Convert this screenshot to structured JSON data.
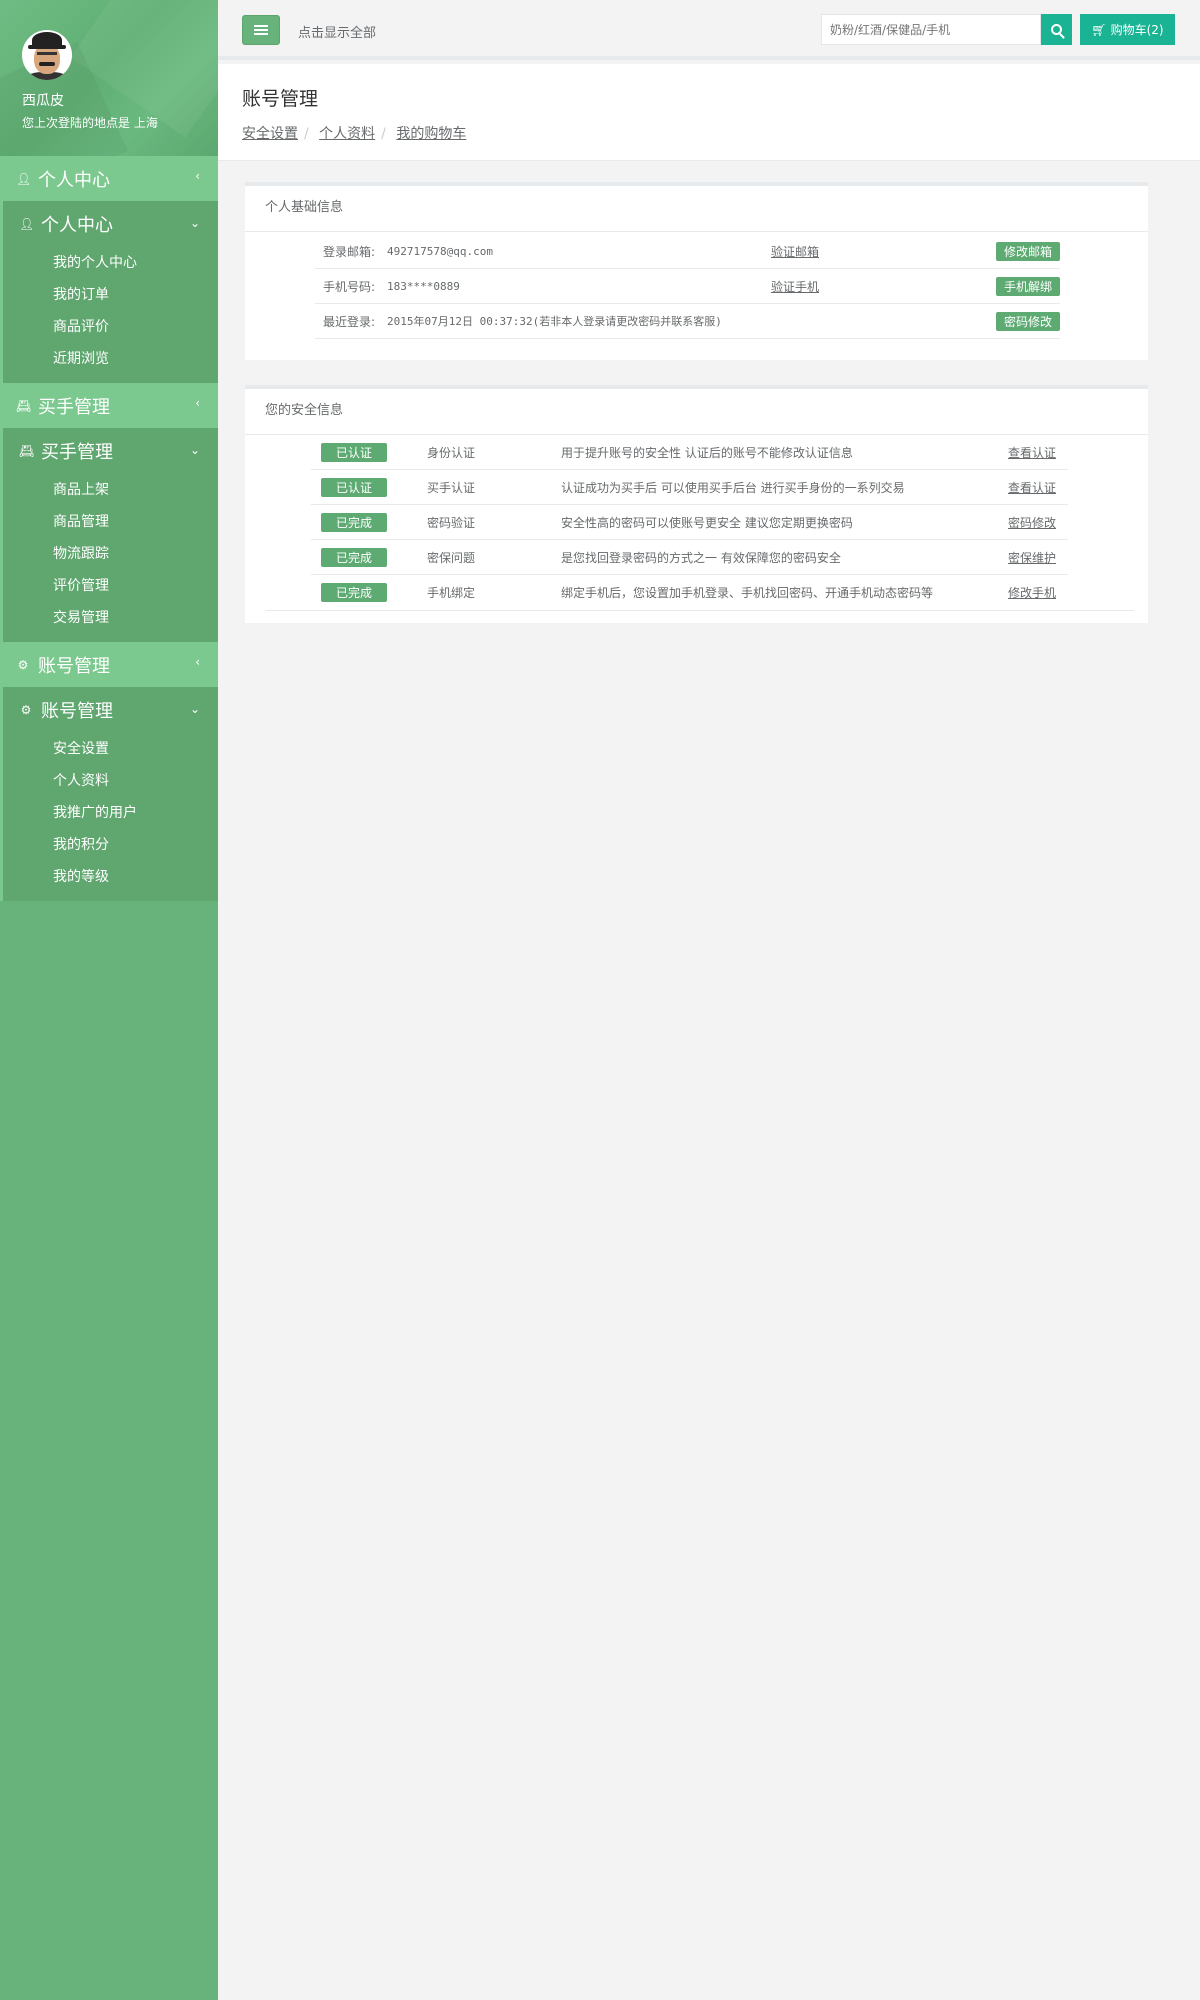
{
  "user": {
    "name": "西瓜皮",
    "last_login_text": "您上次登陆的地点是  上海"
  },
  "sidebar": {
    "sections": [
      {
        "header": "个人中心",
        "icon": "user-icon",
        "sub_header": "个人中心",
        "items": [
          "我的个人中心",
          "我的订单",
          "商品评价",
          "近期浏览"
        ]
      },
      {
        "header": "买手管理",
        "icon": "id-card-icon",
        "sub_header": "买手管理",
        "items": [
          "商品上架",
          "商品管理",
          "物流跟踪",
          "评价管理",
          "交易管理"
        ]
      },
      {
        "header": "账号管理",
        "icon": "gear-icon",
        "sub_header": "账号管理",
        "items": [
          "安全设置",
          "个人资料",
          "我推广的用户",
          "我的积分",
          "我的等级"
        ]
      }
    ]
  },
  "topbar": {
    "show_all": "点击显示全部",
    "search_placeholder": "奶粉/红酒/保健品/手机",
    "cart_label": "购物车(2)"
  },
  "heading": {
    "title": "账号管理",
    "breadcrumbs": [
      "安全设置",
      "个人资料",
      "我的购物车"
    ]
  },
  "basic_info": {
    "title": "个人基础信息",
    "rows": [
      {
        "label": "登录邮箱:",
        "value": "492717578@qq.com",
        "link": "验证邮箱",
        "action": "修改邮箱"
      },
      {
        "label": "手机号码:",
        "value": "183****0889",
        "link": "验证手机",
        "action": "手机解绑"
      },
      {
        "label": "最近登录:",
        "value": "2015年07月12日 00:37:32(若非本人登录请更改密码并联系客服)",
        "link": "",
        "action": "密码修改"
      }
    ]
  },
  "security_info": {
    "title": "您的安全信息",
    "rows": [
      {
        "status": "已认证",
        "name": "身份认证",
        "desc": "用于提升账号的安全性  认证后的账号不能修改认证信息",
        "op": "查看认证"
      },
      {
        "status": "已认证",
        "name": "买手认证",
        "desc": "认证成功为买手后  可以使用买手后台  进行买手身份的一系列交易",
        "op": "查看认证"
      },
      {
        "status": "已完成",
        "name": "密码验证",
        "desc": "安全性高的密码可以使账号更安全  建议您定期更换密码",
        "op": "密码修改"
      },
      {
        "status": "已完成",
        "name": "密保问题",
        "desc": "是您找回登录密码的方式之一  有效保障您的密码安全",
        "op": "密保维护"
      },
      {
        "status": "已完成",
        "name": "手机绑定",
        "desc": "绑定手机后，您设置加手机登录、手机找回密码、开通手机动态密码等",
        "op": "修改手机"
      }
    ]
  },
  "colors": {
    "sidebar": "#68b27b",
    "sidebar_header": "#7cc98f",
    "accent": "#1ab394",
    "tag": "#5eaa73"
  }
}
